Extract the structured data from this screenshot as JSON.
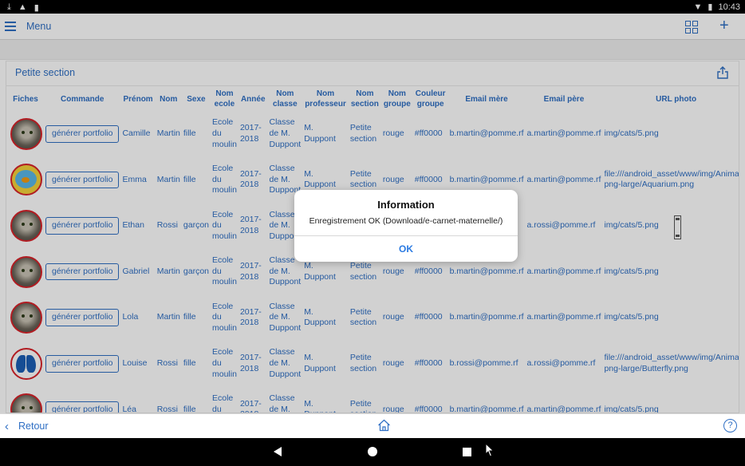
{
  "status_bar": {
    "time": "10:43"
  },
  "top_bar": {
    "menu_label": "Menu",
    "grid_icon": "grid-view-icon",
    "plus_icon": "add-icon"
  },
  "card": {
    "title": "Petite section"
  },
  "table": {
    "headers": [
      "Fiches",
      "Commande",
      "Prénom",
      "Nom",
      "Sexe",
      "Nom ecole",
      "Année",
      "Nom classe",
      "Nom professeur",
      "Nom section",
      "Nom groupe",
      "Couleur groupe",
      "Email mère",
      "Email père",
      "URL photo"
    ],
    "rows": [
      {
        "photo": "cat",
        "button": "générer portfolio",
        "prenom": "Camille",
        "nom": "Martin",
        "sexe": "fille",
        "ecole": "Ecole du moulin",
        "annee": "2017-2018",
        "classe": "Classe de M. Duppont",
        "professeur": "M. Duppont",
        "section": "Petite section",
        "groupe": "rouge",
        "couleur": "#ff0000",
        "email_mere": "b.martin@pomme.rf",
        "email_pere": "a.martin@pomme.rf",
        "url": "img/cats/5.png"
      },
      {
        "photo": "fish",
        "button": "générer portfolio",
        "prenom": "Emma",
        "nom": "Martin",
        "sexe": "fille",
        "ecole": "Ecole du moulin",
        "annee": "2017-2018",
        "classe": "Classe de M. Duppont",
        "professeur": "M. Duppont",
        "section": "Petite section",
        "groupe": "rouge",
        "couleur": "#ff0000",
        "email_mere": "b.martin@pomme.rf",
        "email_pere": "a.martin@pomme.rf",
        "url": "file:///android_asset/www/img/Animals-png-large/Aquarium.png"
      },
      {
        "photo": "cat",
        "button": "générer portfolio",
        "prenom": "Ethan",
        "nom": "Rossi",
        "sexe": "garçon",
        "ecole": "Ecole du moulin",
        "annee": "2017-2018",
        "classe": "Classe de M. Duppont",
        "professeur": "",
        "section": "",
        "groupe": "",
        "couleur": "",
        "email_mere": "",
        "email_pere": "a.rossi@pomme.rf",
        "url": "img/cats/5.png"
      },
      {
        "photo": "cat",
        "button": "générer portfolio",
        "prenom": "Gabriel",
        "nom": "Martin",
        "sexe": "garçon",
        "ecole": "Ecole du moulin",
        "annee": "2017-2018",
        "classe": "Classe de M. Duppont",
        "professeur": "M. Duppont",
        "section": "Petite section",
        "groupe": "rouge",
        "couleur": "#ff0000",
        "email_mere": "b.martin@pomme.rf",
        "email_pere": "a.martin@pomme.rf",
        "url": "img/cats/5.png"
      },
      {
        "photo": "cat",
        "button": "générer portfolio",
        "prenom": "Lola",
        "nom": "Martin",
        "sexe": "fille",
        "ecole": "Ecole du moulin",
        "annee": "2017-2018",
        "classe": "Classe de M. Duppont",
        "professeur": "M. Duppont",
        "section": "Petite section",
        "groupe": "rouge",
        "couleur": "#ff0000",
        "email_mere": "b.martin@pomme.rf",
        "email_pere": "a.martin@pomme.rf",
        "url": "img/cats/5.png"
      },
      {
        "photo": "fly",
        "button": "générer portfolio",
        "prenom": "Louise",
        "nom": "Rossi",
        "sexe": "fille",
        "ecole": "Ecole du moulin",
        "annee": "2017-2018",
        "classe": "Classe de M. Duppont",
        "professeur": "M. Duppont",
        "section": "Petite section",
        "groupe": "rouge",
        "couleur": "#ff0000",
        "email_mere": "b.rossi@pomme.rf",
        "email_pere": "a.rossi@pomme.rf",
        "url": "file:///android_asset/www/img/Animals-png-large/Butterfly.png"
      },
      {
        "photo": "cat",
        "button": "générer portfolio",
        "prenom": "Léa",
        "nom": "Rossi",
        "sexe": "fille",
        "ecole": "Ecole du moulin",
        "annee": "2017-2018",
        "classe": "Classe de M. Duppont",
        "professeur": "M. Duppont",
        "section": "Petite section",
        "groupe": "rouge",
        "couleur": "#ff0000",
        "email_mere": "b.martin@pomme.rf",
        "email_pere": "a.martin@pomme.rf",
        "url": "img/cats/5.png"
      }
    ]
  },
  "dialog": {
    "title": "Information",
    "message": "Enregistrement OK (Download/e-carnet-maternelle/)",
    "ok_label": "OK"
  },
  "bottom_bar": {
    "back_label": "Retour",
    "help_label": "?"
  },
  "colors": {
    "accent": "#2f6fc4",
    "avatar_border": "#d8232a",
    "dialog_button": "#2a7ae2"
  }
}
